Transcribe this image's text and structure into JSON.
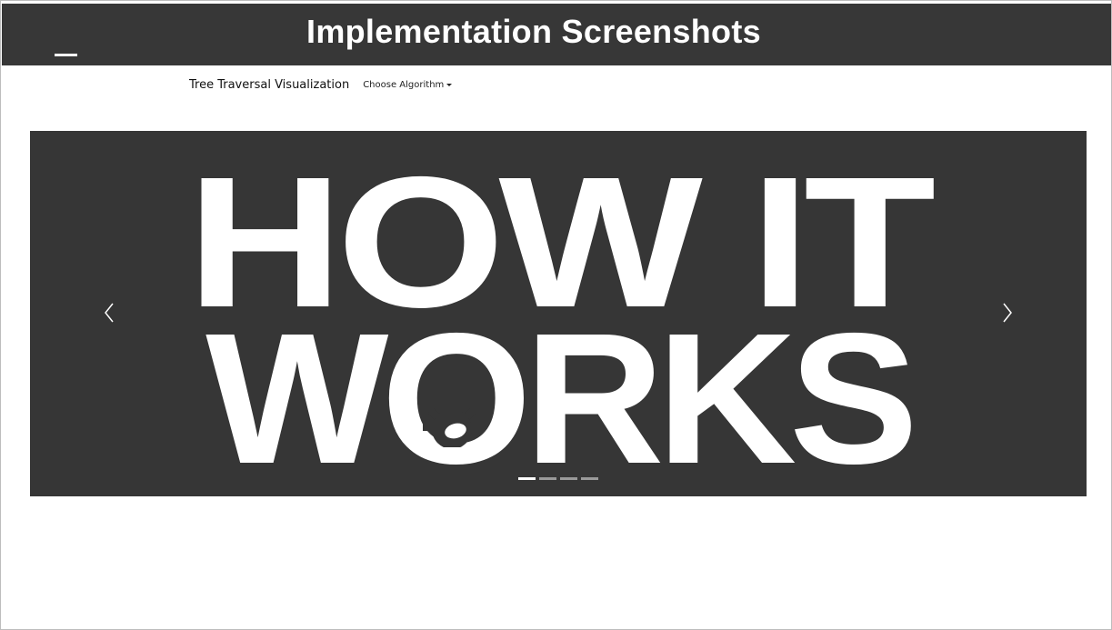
{
  "header": {
    "title": "Implementation Screenshots"
  },
  "navbar": {
    "brand": "Tree Traversal Visualization",
    "dropdown_label": "Choose Algorithm"
  },
  "carousel": {
    "slide_text_line1": "HOW IT",
    "slide_text_line2": "WORKS",
    "slide_count": 4,
    "active_index": 0
  },
  "colors": {
    "header_bg": "#373737",
    "carousel_bg": "#363636",
    "text_light": "#ffffff"
  },
  "icons": {
    "menu": "menu-icon",
    "prev": "chevron-left-icon",
    "next": "chevron-right-icon",
    "gear": "gear-icon"
  }
}
